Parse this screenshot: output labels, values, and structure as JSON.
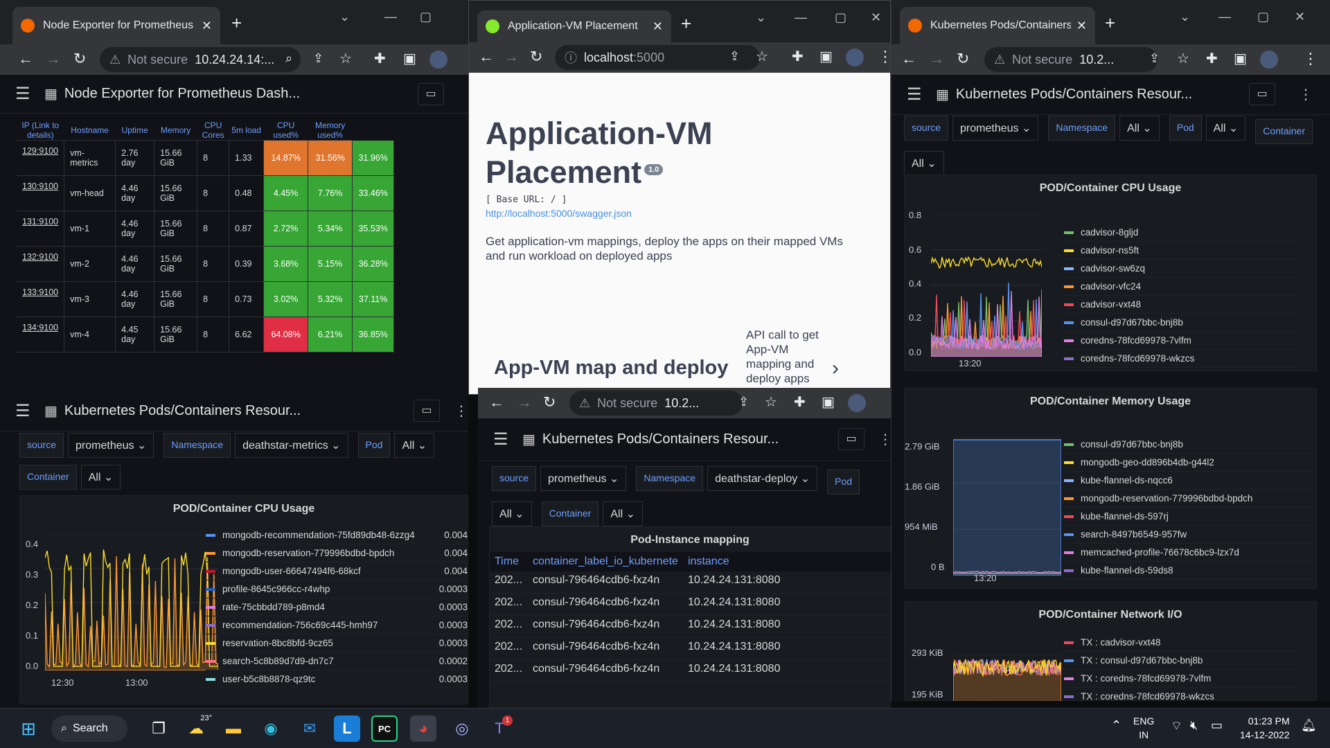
{
  "win1": {
    "tab_title": "Node Exporter for Prometheus D",
    "omni_ns": "Not secure",
    "omni_url": "10.24.24.14:...",
    "dash_title": "Node Exporter for Prometheus Dash...",
    "headers": [
      "IP (Link to details)",
      "Hostname",
      "Uptime",
      "Memory",
      "CPU Cores",
      "5m load",
      "CPU used%",
      "Memory used%"
    ],
    "rows": [
      {
        "ip": "129:9100",
        "host": "vm-metrics",
        "up": "2.76 day",
        "mem": "15.66 GiB",
        "cores": "8",
        "load": "1.33",
        "cpu": "14.87%",
        "memu": "31.56%",
        "disk": "31.96%",
        "cc": "#e0752d",
        "mc": "#e0752d",
        "dc": "#37a635"
      },
      {
        "ip": "130:9100",
        "host": "vm-head",
        "up": "4.46 day",
        "mem": "15.66 GiB",
        "cores": "8",
        "load": "0.48",
        "cpu": "4.45%",
        "memu": "7.76%",
        "disk": "33.46%",
        "cc": "#37a635",
        "mc": "#37a635",
        "dc": "#37a635"
      },
      {
        "ip": "131:9100",
        "host": "vm-1",
        "up": "4.46 day",
        "mem": "15.66 GiB",
        "cores": "8",
        "load": "0.87",
        "cpu": "2.72%",
        "memu": "5.34%",
        "disk": "35.53%",
        "cc": "#37a635",
        "mc": "#37a635",
        "dc": "#37a635"
      },
      {
        "ip": "132:9100",
        "host": "vm-2",
        "up": "4.46 day",
        "mem": "15.66 GiB",
        "cores": "8",
        "load": "0.39",
        "cpu": "3.68%",
        "memu": "5.15%",
        "disk": "36.28%",
        "cc": "#37a635",
        "mc": "#37a635",
        "dc": "#37a635"
      },
      {
        "ip": "133:9100",
        "host": "vm-3",
        "up": "4.46 day",
        "mem": "15.66 GiB",
        "cores": "8",
        "load": "0.73",
        "cpu": "3.02%",
        "memu": "5.32%",
        "disk": "37.11%",
        "cc": "#37a635",
        "mc": "#37a635",
        "dc": "#37a635"
      },
      {
        "ip": "134:9100",
        "host": "vm-4",
        "up": "4.45 day",
        "mem": "15.66 GiB",
        "cores": "8",
        "load": "6.62",
        "cpu": "64.08%",
        "memu": "6.21%",
        "disk": "36.85%",
        "cc": "#e02f44",
        "mc": "#37a635",
        "dc": "#37a635"
      }
    ]
  },
  "win2": {
    "tab_title": "Application-VM Placement",
    "url_host": "localhost",
    "url_port": ":5000",
    "h1": "Application-VM Placement",
    "version": "1.0",
    "base_url": "[ Base URL: / ]",
    "swagger": "http://localhost:5000/swagger.json",
    "desc": "Get application-vm mappings, deploy the apps on their mapped VMs and run workload on deployed apps",
    "section": "App-VM map and deploy",
    "section_desc": "API call to get App-VM mapping and deploy apps to mapped"
  },
  "win3": {
    "tab_title": "Kubernetes Pods/Containers R",
    "omni_ns": "Not secure",
    "omni_url": "10.2...",
    "dash_title": "Kubernetes Pods/Containers Resour...",
    "vars": {
      "source_label": "source",
      "source": "prometheus",
      "ns_label": "Namespace",
      "ns": "All",
      "pod_label": "Pod",
      "pod": "All",
      "container_label": "Container",
      "container": "All"
    },
    "cpu": {
      "title": "POD/Container CPU Usage",
      "y": [
        "0.8",
        "0.6",
        "0.4",
        "0.2",
        "0.0"
      ],
      "x": "13:20",
      "legend": [
        {
          "n": "cadvisor-8gljd",
          "c": "#73bf69"
        },
        {
          "n": "cadvisor-ns5ft",
          "c": "#fade2a"
        },
        {
          "n": "cadvisor-sw6zq",
          "c": "#8ab8ff"
        },
        {
          "n": "cadvisor-vfc24",
          "c": "#ff9830"
        },
        {
          "n": "cadvisor-vxt48",
          "c": "#f2495c"
        },
        {
          "n": "consul-d97d67bbc-bnj8b",
          "c": "#5794f2"
        },
        {
          "n": "coredns-78fcd69978-7vlfm",
          "c": "#e27ee0"
        },
        {
          "n": "coredns-78fcd69978-wkzcs",
          "c": "#8f6bd1"
        }
      ]
    },
    "memory": {
      "title": "POD/Container Memory Usage",
      "y": [
        "2.79 GiB",
        "1.86 GiB",
        "954 MiB",
        "0 B"
      ],
      "x": "13:20",
      "legend": [
        {
          "n": "consul-d97d67bbc-bnj8b",
          "c": "#73bf69"
        },
        {
          "n": "mongodb-geo-dd896b4db-g44l2",
          "c": "#fade2a"
        },
        {
          "n": "kube-flannel-ds-nqcc6",
          "c": "#8ab8ff"
        },
        {
          "n": "mongodb-reservation-779996bdbd-bpdch",
          "c": "#ff9830"
        },
        {
          "n": "kube-flannel-ds-597rj",
          "c": "#f2495c"
        },
        {
          "n": "search-8497b6549-957fw",
          "c": "#5794f2"
        },
        {
          "n": "memcached-profile-76678c6bc9-lzx7d",
          "c": "#e27ee0"
        },
        {
          "n": "kube-flannel-ds-59ds8",
          "c": "#8f6bd1"
        }
      ]
    },
    "net": {
      "title": "POD/Container Network I/O",
      "y": [
        "293 KiB",
        "195 KiB"
      ],
      "legend": [
        {
          "n": "TX : cadvisor-vxt48",
          "c": "#f2495c"
        },
        {
          "n": "TX : consul-d97d67bbc-bnj8b",
          "c": "#5794f2"
        },
        {
          "n": "TX : coredns-78fcd69978-7vlfm",
          "c": "#e27ee0"
        },
        {
          "n": "TX : coredns-78fcd69978-wkzcs",
          "c": "#8f6bd1"
        }
      ]
    }
  },
  "win4": {
    "dash_title": "Kubernetes Pods/Containers Resour...",
    "vars": {
      "source_label": "source",
      "source": "prometheus",
      "ns_label": "Namespace",
      "ns": "deathstar-metrics",
      "pod_label": "Pod",
      "pod": "All",
      "container_label": "Container",
      "container": "All"
    },
    "cpu": {
      "title": "POD/Container CPU Usage",
      "y": [
        "0.4",
        "0.3",
        "0.2",
        "0.1",
        "0.0"
      ],
      "x1": "12:30",
      "x2": "13:00",
      "legend": [
        {
          "n": "mongodb-recommendation-75fd89db48-6zzg4",
          "v": "0.004",
          "c": "#5794f2"
        },
        {
          "n": "mongodb-reservation-779996bdbd-bpdch",
          "v": "0.004",
          "c": "#ff9830"
        },
        {
          "n": "mongodb-user-66647494f6-68kcf",
          "v": "0.004",
          "c": "#c4162a"
        },
        {
          "n": "profile-8645c966cc-r4whp",
          "v": "0.0003",
          "c": "#1f60c4"
        },
        {
          "n": "rate-75cbbdd789-p8md4",
          "v": "0.0003",
          "c": "#e27ee0"
        },
        {
          "n": "recommendation-756c69c445-hmh97",
          "v": "0.0003",
          "c": "#8f6bd1"
        },
        {
          "n": "reservation-8bc8bfd-9cz65",
          "v": "0.0003",
          "c": "#fade2a"
        },
        {
          "n": "search-5c8b89d7d9-dn7c7",
          "v": "0.0002",
          "c": "#ff7383"
        },
        {
          "n": "user-b5c8b8878-qz9tc",
          "v": "0.0003",
          "c": "#8ae1e1"
        }
      ]
    }
  },
  "win5": {
    "omni_ns": "Not secure",
    "omni_url": "10.2...",
    "dash_title": "Kubernetes Pods/Containers Resour...",
    "vars": {
      "source_label": "source",
      "source": "prometheus",
      "ns_label": "Namespace",
      "ns": "deathstar-deploy",
      "pod_label": "Pod",
      "pod": "All",
      "container_label": "Container",
      "container": "All"
    },
    "table": {
      "title": "Pod-Instance mapping",
      "headers": [
        "Time",
        "container_label_io_kubernetes_pod_",
        "instance"
      ],
      "rows": [
        [
          "202...",
          "consul-796464cdb6-fxz4n",
          "10.24.24.131:8080"
        ],
        [
          "202...",
          "consul-796464cdb6-fxz4n",
          "10.24.24.131:8080"
        ],
        [
          "202...",
          "consul-796464cdb6-fxz4n",
          "10.24.24.131:8080"
        ],
        [
          "202...",
          "consul-796464cdb6-fxz4n",
          "10.24.24.131:8080"
        ],
        [
          "202...",
          "consul-796464cdb6-fxz4n",
          "10.24.24.131:8080"
        ]
      ]
    }
  },
  "taskbar": {
    "search": "Search",
    "temp": "23°",
    "lang1": "ENG",
    "lang2": "IN",
    "time": "01:23 PM",
    "date": "14-12-2022",
    "badge": "1"
  }
}
